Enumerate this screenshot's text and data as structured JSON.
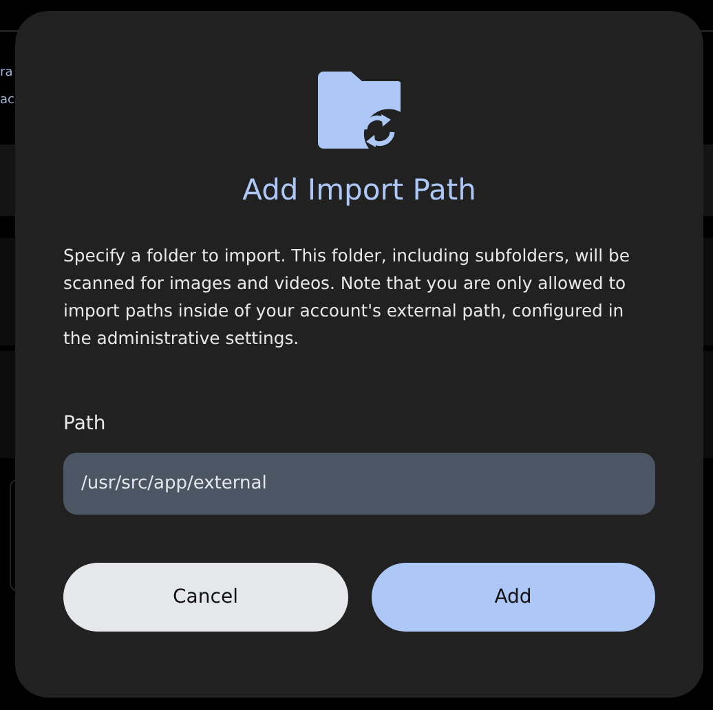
{
  "background": {
    "texts": [
      "ra",
      "ac"
    ]
  },
  "dialog": {
    "title": "Add Import Path",
    "description": "Specify a folder to import. This folder, including subfolders, will be scanned for images and videos. Note that you are only allowed to import paths inside of your account's external path, configured in the administrative settings.",
    "field": {
      "label": "Path",
      "value": "/usr/src/app/external"
    },
    "buttons": [
      {
        "label": "Cancel",
        "kind": "secondary"
      },
      {
        "label": "Add",
        "kind": "primary"
      }
    ]
  }
}
